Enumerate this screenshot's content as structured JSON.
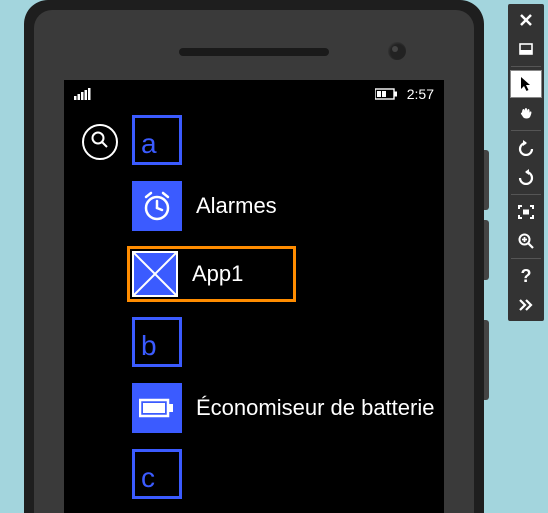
{
  "status": {
    "time": "2:57"
  },
  "search": {},
  "list": {
    "letter_a": "a",
    "alarms_label": "Alarmes",
    "app1_label": "App1",
    "letter_b": "b",
    "battery_saver_label": "Économiseur de batterie",
    "letter_c": "c"
  }
}
